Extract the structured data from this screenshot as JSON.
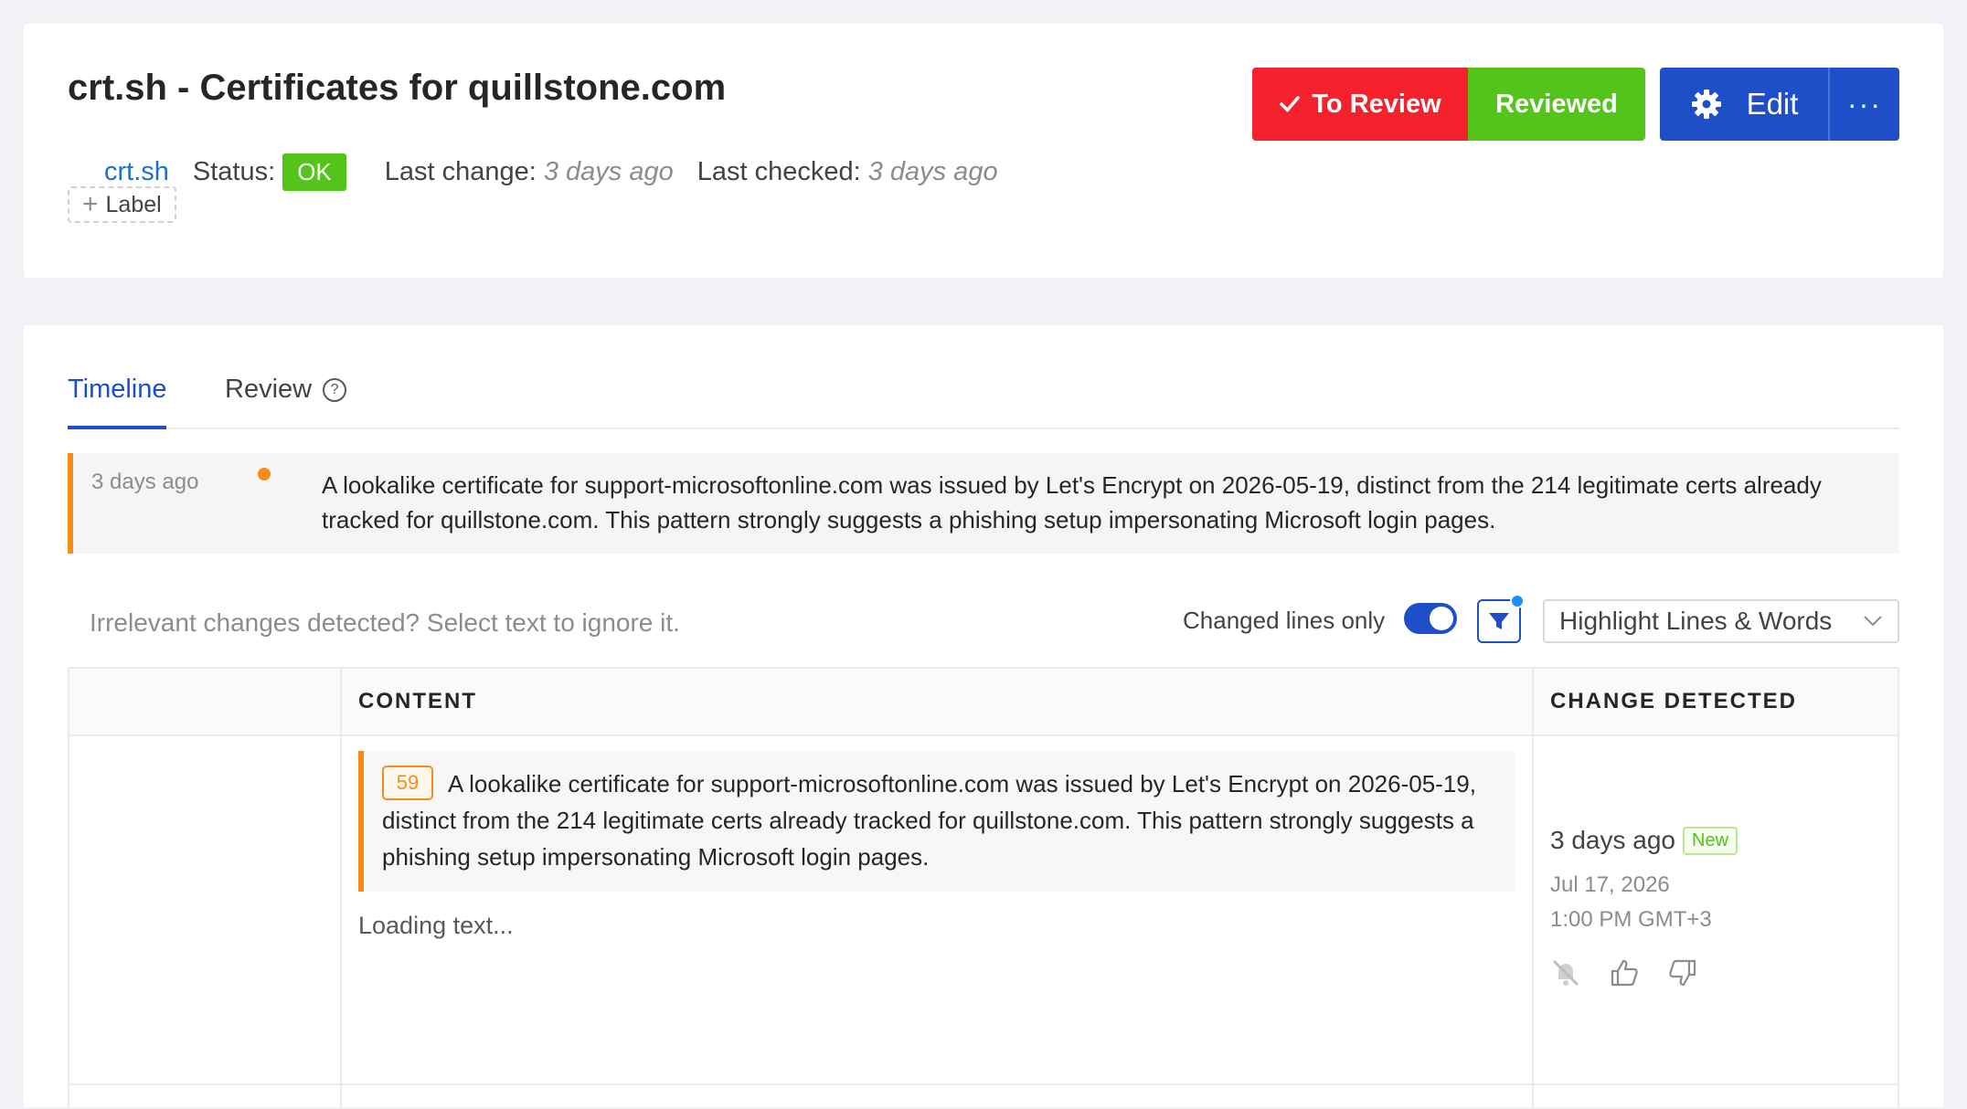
{
  "header": {
    "title": "crt.sh - Certificates for quillstone.com",
    "source_link": "crt.sh",
    "status_label": "Status:",
    "status_value": "OK",
    "last_change_label": "Last change:",
    "last_change_value": "3 days ago",
    "last_checked_label": "Last checked:",
    "last_checked_value": "3 days ago",
    "label_button": "Label",
    "to_review_button": "To Review",
    "reviewed_button": "Reviewed",
    "edit_button": "Edit",
    "more_button": "···"
  },
  "tabs": [
    {
      "label": "Timeline",
      "active": true
    },
    {
      "label": "Review",
      "active": false
    }
  ],
  "summary": {
    "time": "3 days ago",
    "text": "A lookalike certificate for support-microsoftonline.com was issued by Let's Encrypt on 2026-05-19, distinct from the 214 legitimate certs already tracked for quillstone.com. This pattern strongly suggests a phishing setup impersonating Microsoft login pages."
  },
  "toolbar": {
    "ignore_hint": "Irrelevant changes detected? Select text to ignore it.",
    "changed_lines_label": "Changed lines only",
    "changed_lines_on": true,
    "highlight_mode": "Highlight Lines & Words"
  },
  "table": {
    "headers": {
      "content": "CONTENT",
      "change": "CHANGE DETECTED"
    },
    "row": {
      "line_number": "59",
      "change_text": "A lookalike certificate for support-microsoftonline.com was issued by Let's Encrypt on 2026-05-19, distinct from the 214 legitimate certs already tracked for quillstone.com. This pattern strongly suggests a phishing setup impersonating Microsoft login pages.",
      "loading": "Loading text...",
      "detected_relative": "3 days ago",
      "new_badge": "New",
      "detected_date": "Jul 17, 2026",
      "detected_time": "1:00 PM GMT+3"
    }
  },
  "colors": {
    "primary": "#1f4fc8",
    "danger": "#f5222d",
    "success": "#52c41a",
    "warning": "#fa8c16"
  },
  "icons": [
    "check-icon",
    "gear-icon",
    "plus-icon",
    "help-icon",
    "filter-icon",
    "chevron-down-icon",
    "mute-icon",
    "thumbs-up-icon",
    "thumbs-down-icon"
  ]
}
